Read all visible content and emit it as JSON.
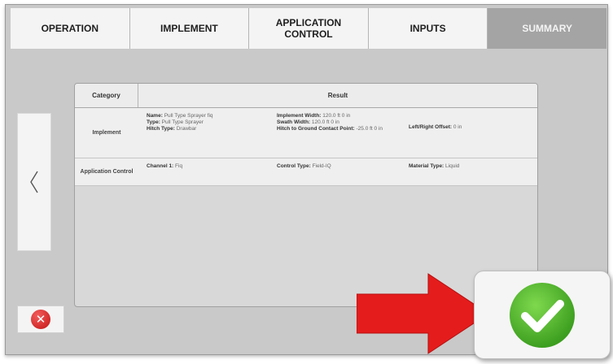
{
  "tabs": [
    {
      "label": "OPERATION",
      "active": false
    },
    {
      "label": "IMPLEMENT",
      "active": false
    },
    {
      "label": "APPLICATION\nCONTROL",
      "active": false
    },
    {
      "label": "INPUTS",
      "active": false
    },
    {
      "label": "SUMMARY",
      "active": true
    }
  ],
  "nav": {
    "back_icon": "chevron-left-icon"
  },
  "summary_table": {
    "headers": {
      "category": "Category",
      "result": "Result"
    },
    "rows": [
      {
        "category": "Implement",
        "columns": [
          [
            {
              "key": "Name:",
              "value": "Pull Type Sprayer fiq"
            },
            {
              "key": "Type:",
              "value": "Pull Type Sprayer"
            },
            {
              "key": "Hitch Type:",
              "value": "Drawbar"
            }
          ],
          [
            {
              "key": "Implement Width:",
              "value": "120.0 ft 0 in"
            },
            {
              "key": "Swath Width:",
              "value": "120.0 ft 0 in"
            },
            {
              "key": "Hitch to Ground Contact Point:",
              "value": "-25.0 ft 0 in"
            }
          ],
          [
            {
              "key": "Left/Right Offset:",
              "value": "0 in"
            }
          ]
        ]
      },
      {
        "category": "Application Control",
        "columns": [
          [
            {
              "key": "Channel 1:",
              "value": "Fiq"
            }
          ],
          [
            {
              "key": "Control Type:",
              "value": "Field-IQ"
            }
          ],
          [
            {
              "key": "Material Type:",
              "value": "Liquid"
            }
          ]
        ]
      }
    ]
  },
  "buttons": {
    "cancel_icon": "close-icon",
    "confirm_icon": "checkmark-icon"
  },
  "annotation": {
    "arrow_icon": "red-arrow-icon",
    "color": "#e51c1c"
  },
  "colors": {
    "active_tab": "#a4a4a4",
    "confirm_green": "#4caf2a",
    "cancel_red": "#d42020"
  }
}
